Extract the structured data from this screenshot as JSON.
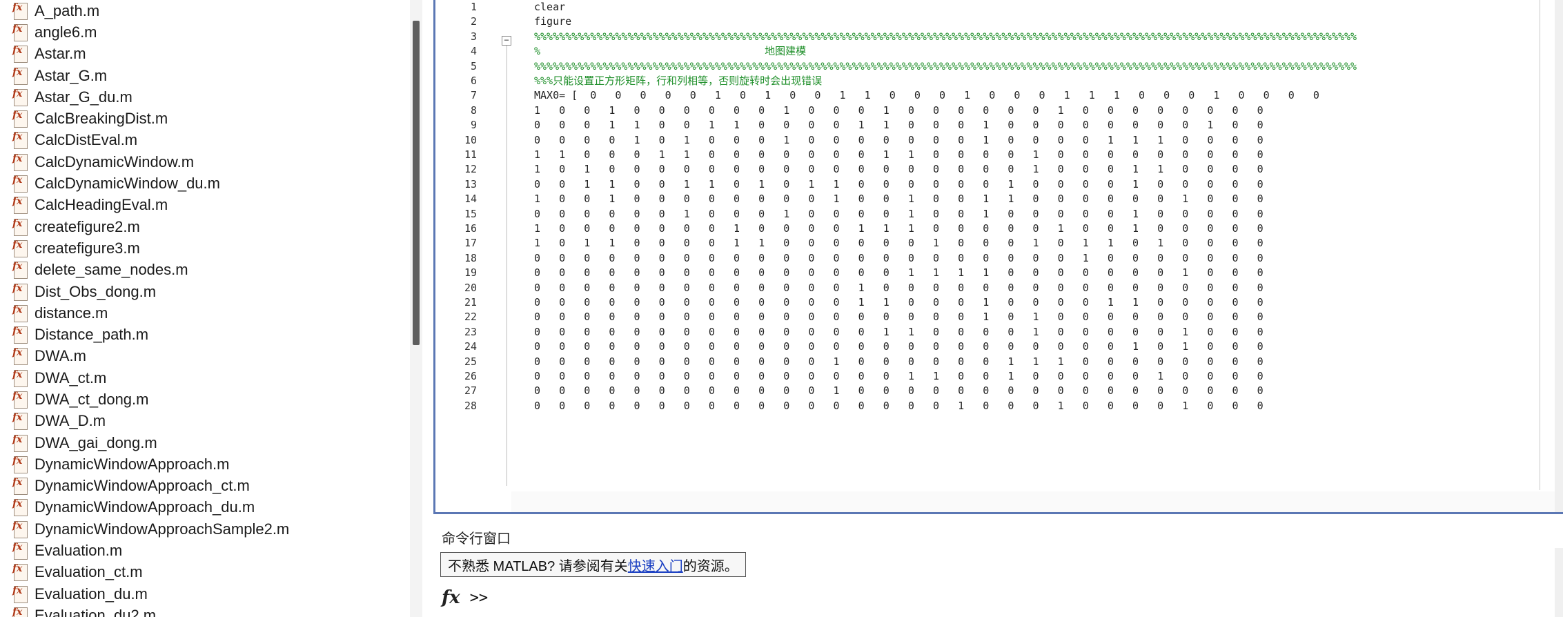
{
  "files": [
    "A_path.m",
    "angle6.m",
    "Astar.m",
    "Astar_G.m",
    "Astar_G_du.m",
    "CalcBreakingDist.m",
    "CalcDistEval.m",
    "CalcDynamicWindow.m",
    "CalcDynamicWindow_du.m",
    "CalcHeadingEval.m",
    "createfigure2.m",
    "createfigure3.m",
    "delete_same_nodes.m",
    "Dist_Obs_dong.m",
    "distance.m",
    "Distance_path.m",
    "DWA.m",
    "DWA_ct.m",
    "DWA_ct_dong.m",
    "DWA_D.m",
    "DWA_gai_dong.m",
    "DynamicWindowApproach.m",
    "DynamicWindowApproach_ct.m",
    "DynamicWindowApproach_du.m",
    "DynamicWindowApproachSample2.m",
    "Evaluation.m",
    "Evaluation_ct.m",
    "Evaluation_du.m",
    "Evaluation_du2.m"
  ],
  "editor": {
    "line_numbers": [
      "1",
      "2",
      "3",
      "4",
      "5",
      "6",
      "7",
      "8",
      "9",
      "10",
      "11",
      "12",
      "13",
      "14",
      "15",
      "16",
      "17",
      "18",
      "19",
      "20",
      "21",
      "22",
      "23",
      "24",
      "25",
      "26",
      "27",
      "28"
    ],
    "lines": [
      {
        "text": "clear",
        "comment": false
      },
      {
        "text": "figure",
        "comment": false
      },
      {
        "text": "%%%%%%%%%%%%%%%%%%%%%%%%%%%%%%%%%%%%%%%%%%%%%%%%%%%%%%%%%%%%%%%%%%%%%%%%%%%%%%%%%%%%%%%%%%%%%%%%%%%%%%%%%%%%%%%%%%%%%%%%%%%%%%%%%%%%",
        "comment": true
      },
      {
        "text": "%                                    地图建模",
        "comment": true
      },
      {
        "text": "%%%%%%%%%%%%%%%%%%%%%%%%%%%%%%%%%%%%%%%%%%%%%%%%%%%%%%%%%%%%%%%%%%%%%%%%%%%%%%%%%%%%%%%%%%%%%%%%%%%%%%%%%%%%%%%%%%%%%%%%%%%%%%%%%%%%",
        "comment": true
      },
      {
        "text": "%%%只能设置正方形矩阵，行和列相等，否则旋转时会出现错误",
        "comment": true
      },
      {
        "text": "MAX0= [  0   0   0   0   0   1   0   1   0   0   1   1   0   0   0   1   0   0   0   1   1   1   0   0   0   1   0   0   0   0",
        "comment": false
      },
      {
        "text": "1   0   0   1   0   0   0   0   0   0   1   0   0   0   1   0   0   0   0   0   0   1   0   0   0   0   0   0   0   0",
        "comment": false
      },
      {
        "text": "0   0   0   1   1   0   0   1   1   0   0   0   0   1   1   0   0   0   1   0   0   0   0   0   0   0   0   1   0   0",
        "comment": false
      },
      {
        "text": "0   0   0   0   1   0   1   0   0   0   1   0   0   0   0   0   0   0   1   0   0   0   0   1   1   1   0   0   0   0",
        "comment": false
      },
      {
        "text": "1   1   0   0   0   1   1   0   0   0   0   0   0   0   1   1   0   0   0   0   1   0   0   0   0   0   0   0   0   0",
        "comment": false
      },
      {
        "text": "1   0   1   0   0   0   0   0   0   0   0   0   0   0   0   0   0   0   0   0   1   0   0   0   1   1   0   0   0   0",
        "comment": false
      },
      {
        "text": "0   0   1   1   0   0   1   1   0   1   0   1   1   0   0   0   0   0   0   1   0   0   0   0   1   0   0   0   0   0",
        "comment": false
      },
      {
        "text": "1   0   0   1   0   0   0   0   0   0   0   0   1   0   0   1   0   0   1   1   0   0   0   0   0   0   1   0   0   0",
        "comment": false
      },
      {
        "text": "0   0   0   0   0   0   1   0   0   0   1   0   0   0   0   1   0   0   1   0   0   0   0   0   1   0   0   0   0   0",
        "comment": false
      },
      {
        "text": "1   0   0   0   0   0   0   0   1   0   0   0   0   1   1   1   0   0   0   0   0   1   0   0   1   0   0   0   0   0",
        "comment": false
      },
      {
        "text": "1   0   1   1   0   0   0   0   1   1   0   0   0   0   0   0   1   0   0   0   1   0   1   1   0   1   0   0   0   0",
        "comment": false
      },
      {
        "text": "0   0   0   0   0   0   0   0   0   0   0   0   0   0   0   0   0   0   0   0   0   0   1   0   0   0   0   0   0   0",
        "comment": false
      },
      {
        "text": "0   0   0   0   0   0   0   0   0   0   0   0   0   0   0   1   1   1   1   0   0   0   0   0   0   0   1   0   0   0",
        "comment": false
      },
      {
        "text": "0   0   0   0   0   0   0   0   0   0   0   0   0   1   0   0   0   0   0   0   0   0   0   0   0   0   0   0   0   0",
        "comment": false
      },
      {
        "text": "0   0   0   0   0   0   0   0   0   0   0   0   0   1   1   0   0   0   1   0   0   0   0   1   1   0   0   0   0   0",
        "comment": false
      },
      {
        "text": "0   0   0   0   0   0   0   0   0   0   0   0   0   0   0   0   0   0   1   0   1   0   0   0   0   0   0   0   0   0",
        "comment": false
      },
      {
        "text": "0   0   0   0   0   0   0   0   0   0   0   0   0   0   1   1   0   0   0   0   1   0   0   0   0   0   1   0   0   0",
        "comment": false
      },
      {
        "text": "0   0   0   0   0   0   0   0   0   0   0   0   0   0   0   0   0   0   0   0   0   0   0   0   1   0   1   0   0   0",
        "comment": false
      },
      {
        "text": "0   0   0   0   0   0   0   0   0   0   0   0   1   0   0   0   0   0   0   1   1   1   0   0   0   0   0   0   0   0",
        "comment": false
      },
      {
        "text": "0   0   0   0   0   0   0   0   0   0   0   0   0   0   0   1   1   0   0   1   0   0   0   0   0   1   0   0   0   0",
        "comment": false
      },
      {
        "text": "0   0   0   0   0   0   0   0   0   0   0   0   1   0   0   0   0   0   0   0   0   0   0   0   0   0   0   0   0   0",
        "comment": false
      },
      {
        "text": "0   0   0   0   0   0   0   0   0   0   0   0   0   0   0   0   0   1   0   0   0   1   0   0   0   0   1   0   0   0",
        "comment": false
      }
    ]
  },
  "command_window": {
    "title": "命令行窗口",
    "notice_before": "不熟悉 MATLAB? 请参阅有关",
    "notice_link": "快速入门",
    "notice_after": "的资源。",
    "fx_icon": "fx",
    "prompt": ">>"
  },
  "colors": {
    "comment": "#1f8f2a",
    "link": "#1a3fc2",
    "editor_border": "#5b77b4"
  }
}
